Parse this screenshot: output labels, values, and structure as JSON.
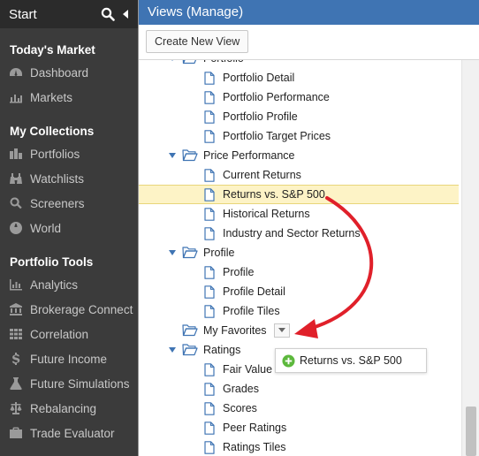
{
  "sidebar": {
    "title": "Start",
    "sections": [
      {
        "title": "Today's Market",
        "items": [
          {
            "label": "Dashboard",
            "icon": "dashboard-icon"
          },
          {
            "label": "Markets",
            "icon": "markets-icon"
          }
        ]
      },
      {
        "title": "My Collections",
        "items": [
          {
            "label": "Portfolios",
            "icon": "portfolios-icon"
          },
          {
            "label": "Watchlists",
            "icon": "binoculars-icon"
          },
          {
            "label": "Screeners",
            "icon": "search-icon"
          },
          {
            "label": "World",
            "icon": "globe-icon"
          }
        ]
      },
      {
        "title": "Portfolio Tools",
        "items": [
          {
            "label": "Analytics",
            "icon": "analytics-icon"
          },
          {
            "label": "Brokerage Connect",
            "icon": "bank-icon"
          },
          {
            "label": "Correlation",
            "icon": "grid-icon"
          },
          {
            "label": "Future Income",
            "icon": "dollar-icon"
          },
          {
            "label": "Future Simulations",
            "icon": "flask-icon"
          },
          {
            "label": "Rebalancing",
            "icon": "balance-icon"
          },
          {
            "label": "Trade Evaluator",
            "icon": "briefcase-icon"
          }
        ]
      }
    ]
  },
  "main": {
    "title": "Views (Manage)",
    "create_label": "Create New View",
    "tree": [
      {
        "label": "Portfolio",
        "type": "folder",
        "level": 1,
        "expanded": true,
        "clipped": true
      },
      {
        "label": "Portfolio Detail",
        "type": "item",
        "level": 2
      },
      {
        "label": "Portfolio Performance",
        "type": "item",
        "level": 2
      },
      {
        "label": "Portfolio Profile",
        "type": "item",
        "level": 2
      },
      {
        "label": "Portfolio Target Prices",
        "type": "item",
        "level": 2
      },
      {
        "label": "Price Performance",
        "type": "folder",
        "level": 1,
        "expanded": true
      },
      {
        "label": "Current Returns",
        "type": "item",
        "level": 2
      },
      {
        "label": "Returns vs. S&P 500",
        "type": "item",
        "level": 2,
        "selected": true
      },
      {
        "label": "Historical Returns",
        "type": "item",
        "level": 2
      },
      {
        "label": "Industry and Sector Returns",
        "type": "item",
        "level": 2
      },
      {
        "label": "Profile",
        "type": "folder",
        "level": 1,
        "expanded": true
      },
      {
        "label": "Profile",
        "type": "item",
        "level": 2
      },
      {
        "label": "Profile Detail",
        "type": "item",
        "level": 2
      },
      {
        "label": "Profile Tiles",
        "type": "item",
        "level": 2
      },
      {
        "label": "My Favorites",
        "type": "folder",
        "level": 1,
        "expanded": false,
        "dropdown": true
      },
      {
        "label": "Ratings",
        "type": "folder",
        "level": 1,
        "expanded": true
      },
      {
        "label": "Fair Value",
        "type": "item",
        "level": 2
      },
      {
        "label": "Grades",
        "type": "item",
        "level": 2
      },
      {
        "label": "Scores",
        "type": "item",
        "level": 2
      },
      {
        "label": "Peer Ratings",
        "type": "item",
        "level": 2
      },
      {
        "label": "Ratings Tiles",
        "type": "item",
        "level": 2
      }
    ],
    "drag_ghost_label": "Returns vs. S&P 500"
  },
  "colors": {
    "header_blue": "#3f74b3",
    "sidebar_bg": "#3b3b3b",
    "selected_row": "#fdf3c6",
    "arrow_red": "#e0202a",
    "add_green": "#5cb83c"
  }
}
